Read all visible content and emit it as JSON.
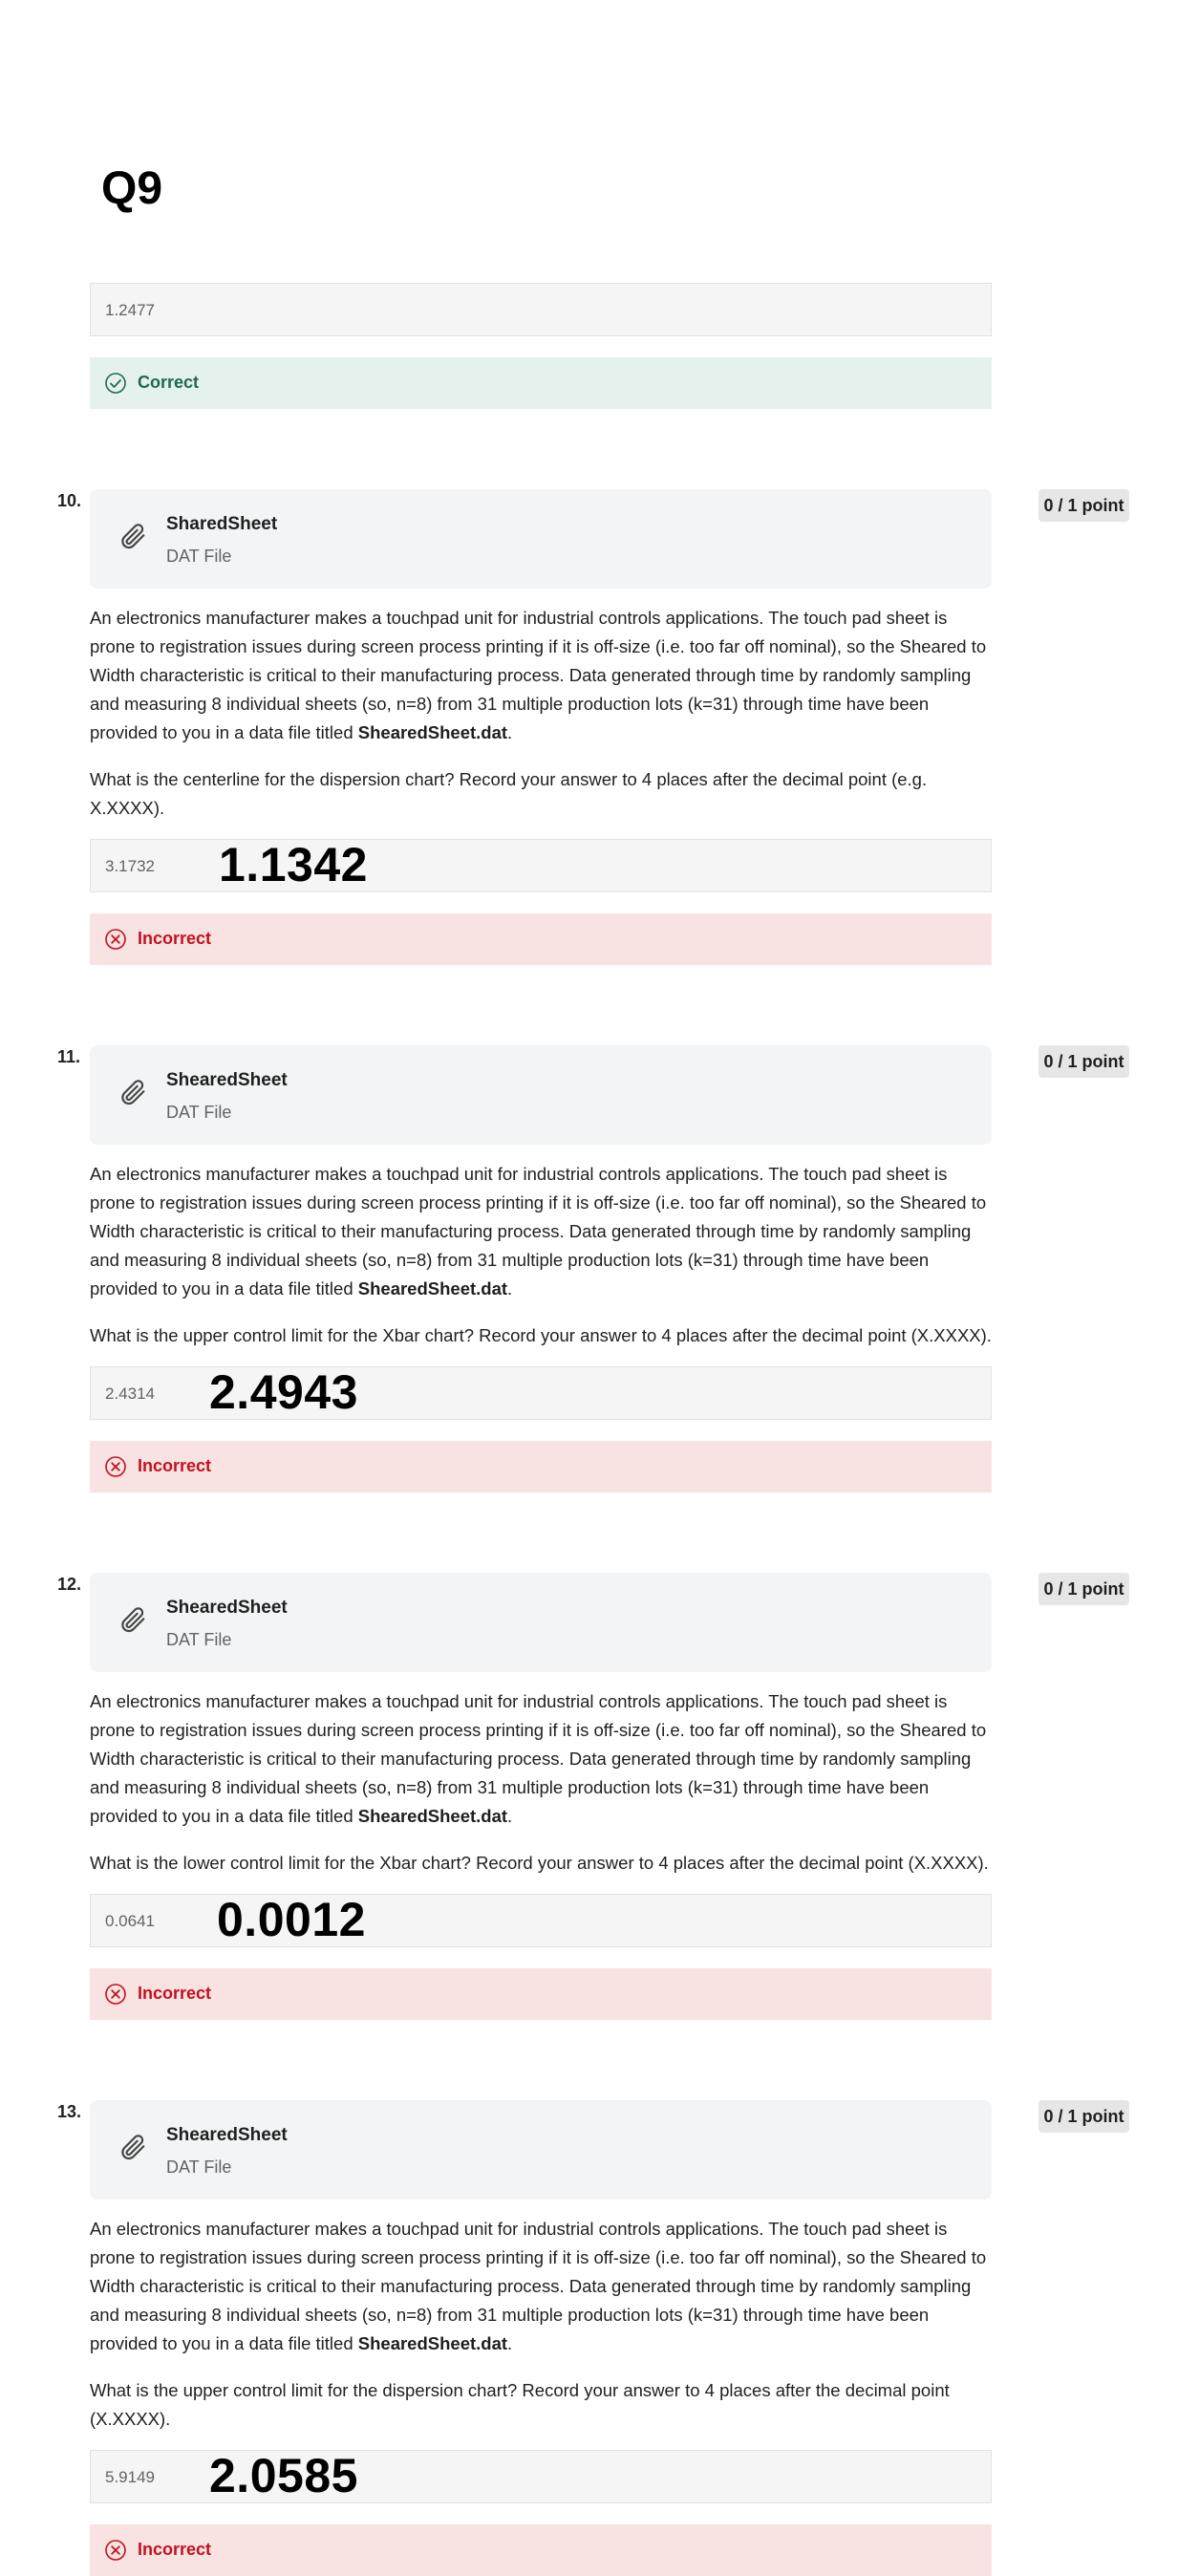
{
  "page_title": "Q9",
  "q9": {
    "answer_value": "1.2477",
    "feedback": "Correct"
  },
  "questions": [
    {
      "number": "10.",
      "points": "0 / 1 point",
      "attachment_name": "SharedSheet",
      "attachment_type": "DAT File",
      "prompt_text": "An electronics manufacturer makes a touchpad unit for industrial controls applications. The touch pad sheet is prone to registration issues during screen process printing if it is off-size (i.e. too far off nominal), so the Sheared to Width characteristic is critical to their manufacturing process. Data generated through time by randomly sampling and measuring 8 individual sheets (so, n=8) from 31 multiple production lots (k=31) through time have been provided to you in a data file titled ",
      "file_ref": "ShearedSheet.dat",
      "question_text": "What is the centerline for the dispersion chart? Record your answer to 4 places after the decimal point (e.g. X.XXXX).",
      "answer_value": "3.1732",
      "handwritten_answer": "1.1342",
      "feedback": "Incorrect"
    },
    {
      "number": "11.",
      "points": "0 / 1 point",
      "attachment_name": "ShearedSheet",
      "attachment_type": "DAT File",
      "prompt_text": "An electronics manufacturer makes a touchpad unit for industrial controls applications. The touch pad sheet is prone to registration issues during screen process printing if it is off-size (i.e. too far off nominal), so the Sheared to Width characteristic is critical to their manufacturing process. Data generated through time by randomly sampling and measuring 8 individual sheets (so, n=8) from 31 multiple production lots (k=31) through time have been provided to you in a data file titled ",
      "file_ref": "ShearedSheet.dat",
      "question_text": "What is the upper control limit for the Xbar chart? Record your answer to 4 places after the decimal point (X.XXXX).",
      "answer_value": "2.4314",
      "handwritten_answer": "2.4943",
      "feedback": "Incorrect"
    },
    {
      "number": "12.",
      "points": "0 / 1 point",
      "attachment_name": "ShearedSheet",
      "attachment_type": "DAT File",
      "prompt_text": "An electronics manufacturer makes a touchpad unit for industrial controls applications. The touch pad sheet is prone to registration issues during screen process printing if it is off-size (i.e. too far off nominal), so the Sheared to Width characteristic is critical to their manufacturing process. Data generated through time by randomly sampling and measuring 8 individual sheets (so, n=8) from 31 multiple production lots (k=31) through time have been provided to you in a data file titled ",
      "file_ref": "ShearedSheet.dat",
      "question_text": "What is the lower control limit for the Xbar chart? Record your answer to 4 places after the decimal point (X.XXXX).",
      "answer_value": "0.0641",
      "handwritten_answer": "0.0012",
      "feedback": "Incorrect"
    },
    {
      "number": "13.",
      "points": "0 / 1 point",
      "attachment_name": "ShearedSheet",
      "attachment_type": "DAT File",
      "prompt_text": "An electronics manufacturer makes a touchpad unit for industrial controls applications. The touch pad sheet is prone to registration issues during screen process printing if it is off-size (i.e. too far off nominal), so the Sheared to Width characteristic is critical to their manufacturing process. Data generated through time by randomly sampling and measuring 8 individual sheets (so, n=8) from 31 multiple production lots (k=31) through time have been provided to you in a data file titled ",
      "file_ref": "ShearedSheet.dat",
      "question_text": "What is the upper control limit for the dispersion chart? Record your answer to 4 places after the decimal point (X.XXXX).",
      "answer_value": "5.9149",
      "handwritten_answer": "2.0585",
      "feedback": "Incorrect"
    }
  ],
  "colors": {
    "correct_bg": "#e4f1ec",
    "correct_text": "#1e6b4c",
    "incorrect_bg": "#f9e2e2",
    "incorrect_text": "#c1121f",
    "panel_bg": "#f3f4f5"
  },
  "icons": {
    "attachment": "paperclip-icon",
    "correct": "check-circle-icon",
    "incorrect": "x-circle-icon"
  }
}
